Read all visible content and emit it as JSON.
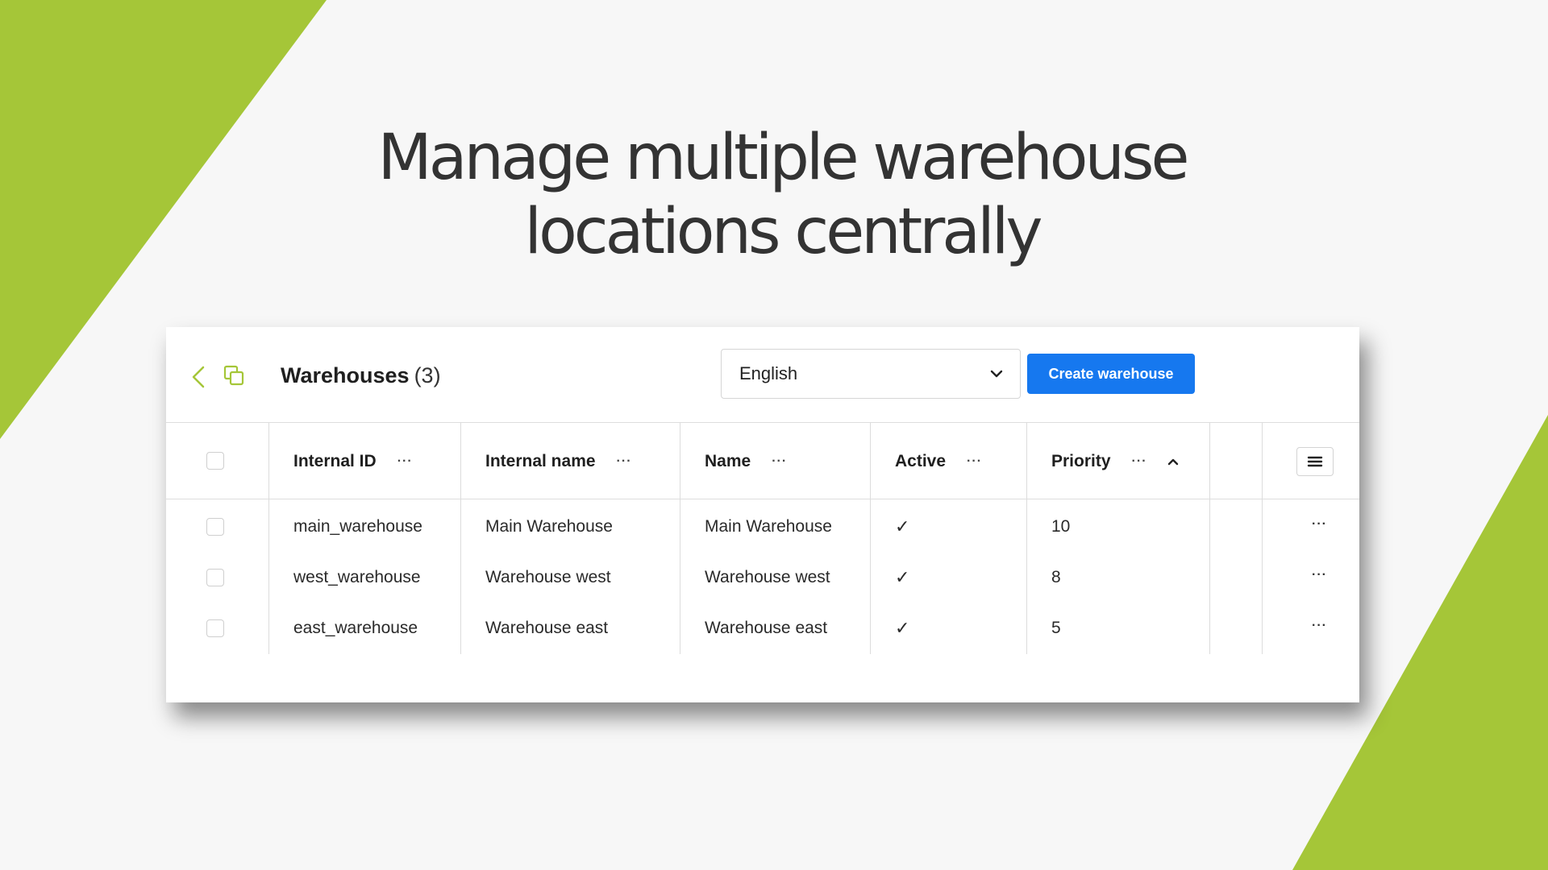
{
  "headline": {
    "line1": "Manage multiple warehouse",
    "line2": "locations centrally"
  },
  "colors": {
    "accent_green": "#a5c638",
    "primary_blue": "#1678ef"
  },
  "toolbar": {
    "back_icon": "chevron-left-icon",
    "copy_icon": "copy-icon",
    "title": "Warehouses",
    "count": "(3)",
    "language": {
      "selected": "English"
    },
    "create_label": "Create warehouse"
  },
  "table": {
    "columns": [
      {
        "label": "Internal ID",
        "more": "···"
      },
      {
        "label": "Internal name",
        "more": "···"
      },
      {
        "label": "Name",
        "more": "···"
      },
      {
        "label": "Active",
        "more": "···"
      },
      {
        "label": "Priority",
        "more": "···",
        "sort": "ascending"
      }
    ],
    "rows": [
      {
        "internal_id": "main_warehouse",
        "internal_name": "Main Warehouse",
        "name": "Main Warehouse",
        "active": "✓",
        "priority": "10",
        "more": "···"
      },
      {
        "internal_id": "west_warehouse",
        "internal_name": "Warehouse west",
        "name": "Warehouse west",
        "active": "✓",
        "priority": "8",
        "more": "···"
      },
      {
        "internal_id": "east_warehouse",
        "internal_name": "Warehouse east",
        "name": "Warehouse east",
        "active": "✓",
        "priority": "5",
        "more": "···"
      }
    ]
  }
}
